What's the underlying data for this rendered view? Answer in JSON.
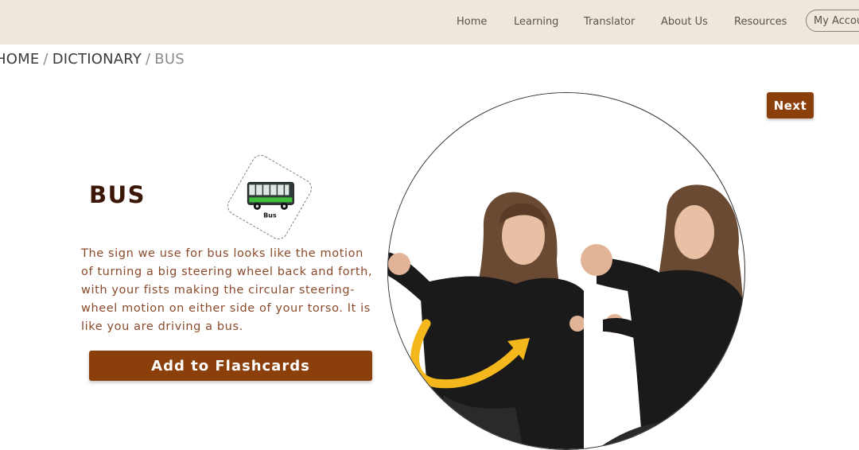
{
  "nav": {
    "home": "Home",
    "learning": "Learning",
    "translator": "Translator",
    "about": "About Us",
    "resources": "Resources",
    "account": "My Account"
  },
  "breadcrumb": {
    "home": "HOME",
    "dictionary": "DICTIONARY",
    "current": "BUS",
    "separator": "/"
  },
  "word": {
    "title": "BUS",
    "sticker_label": "Bus",
    "description": "The sign we use for bus looks like the motion of turning a big steering wheel back and forth, with your fists making the circular steering-wheel motion on either side of your torso. It is like you are driving a bus."
  },
  "actions": {
    "add_flashcards": "Add to Flashcards",
    "next": "Next"
  },
  "colors": {
    "nav_bg": "#efe6dc",
    "button_bg": "#8b3f0b",
    "title": "#3b1708",
    "description": "#8a4a2b",
    "arrow": "#f5b81c"
  },
  "icons": {
    "sticker": "bus-sticker-icon",
    "motion_arrow": "curved-arrow-icon"
  }
}
